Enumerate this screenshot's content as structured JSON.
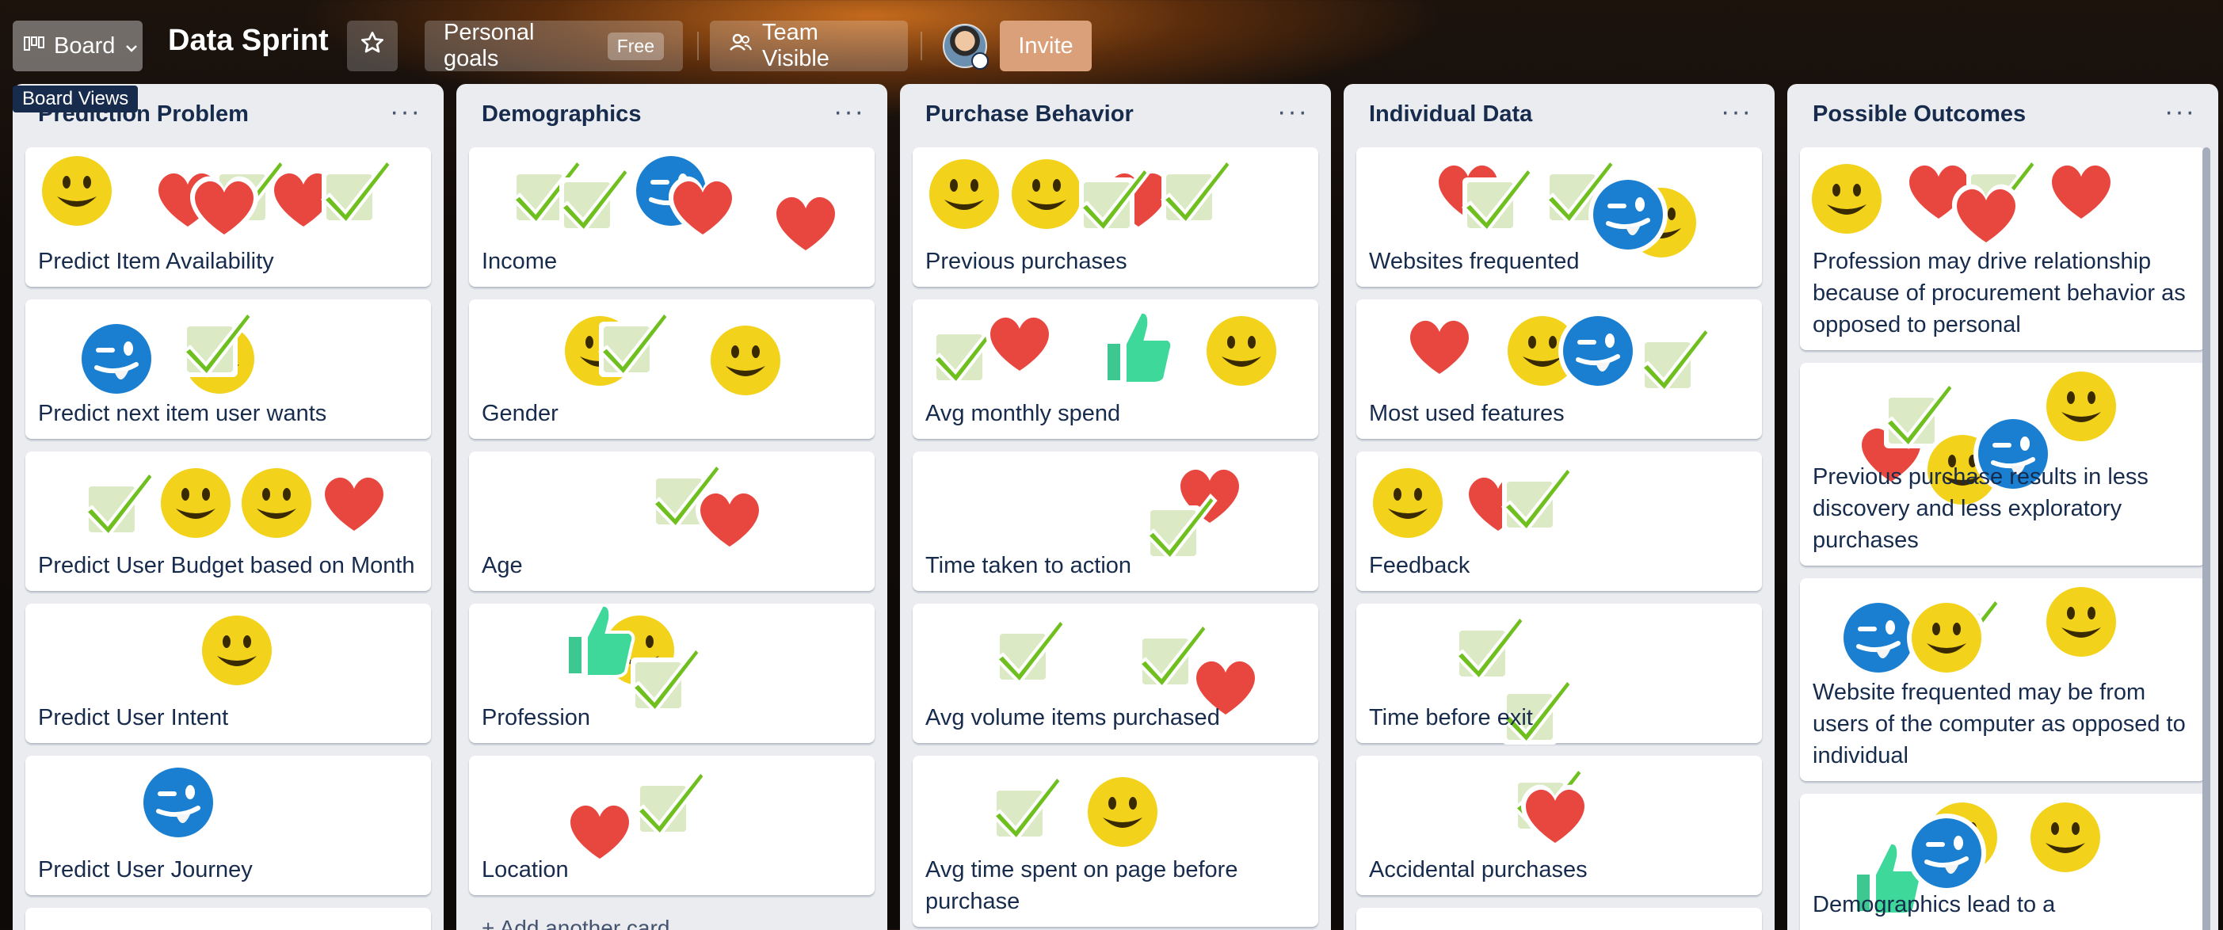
{
  "header": {
    "view_label": "Board",
    "board_title": "Data Sprint",
    "goals_label": "Personal goals",
    "goals_badge": "Free",
    "visibility_label": "Team Visible",
    "invite_label": "Invite",
    "tooltip": "Board Views"
  },
  "lists": [
    {
      "title": "Prediction Problem",
      "cards": [
        "Predict Item Availability",
        "Predict next item user wants",
        "Predict User Budget based on Month",
        "Predict User Intent",
        "Predict User Journey"
      ]
    },
    {
      "title": "Demographics",
      "cards": [
        "Income",
        "Gender",
        "Age",
        "Profession",
        "Location"
      ],
      "add_card": "+ Add another card"
    },
    {
      "title": "Purchase Behavior",
      "cards": [
        "Previous purchases",
        "Avg monthly spend",
        "Time taken to action",
        "Avg volume items purchased",
        "Avg time spent on page before purchase"
      ]
    },
    {
      "title": "Individual Data",
      "cards": [
        "Websites frequented",
        "Most used features",
        "Feedback",
        "Time before exit",
        "Accidental purchases"
      ]
    },
    {
      "title": "Possible Outcomes",
      "cards": [
        "Profession may drive relationship because of procurement behavior as opposed to personal",
        "Previous purchase results in less discovery and less exploratory purchases",
        "Website frequented may be from users of the computer as opposed to individual",
        "Demographics lead to a"
      ]
    }
  ],
  "colors": {
    "card_bg": "#ffffff",
    "list_bg": "#ebecf0",
    "text": "#172b4d"
  },
  "icons": [
    "board-icon",
    "chevron-down-icon",
    "star-icon",
    "team-icon",
    "smiley-sticker",
    "heart-sticker",
    "check-sticker",
    "thumbs-up-sticker",
    "wink-sticker"
  ]
}
